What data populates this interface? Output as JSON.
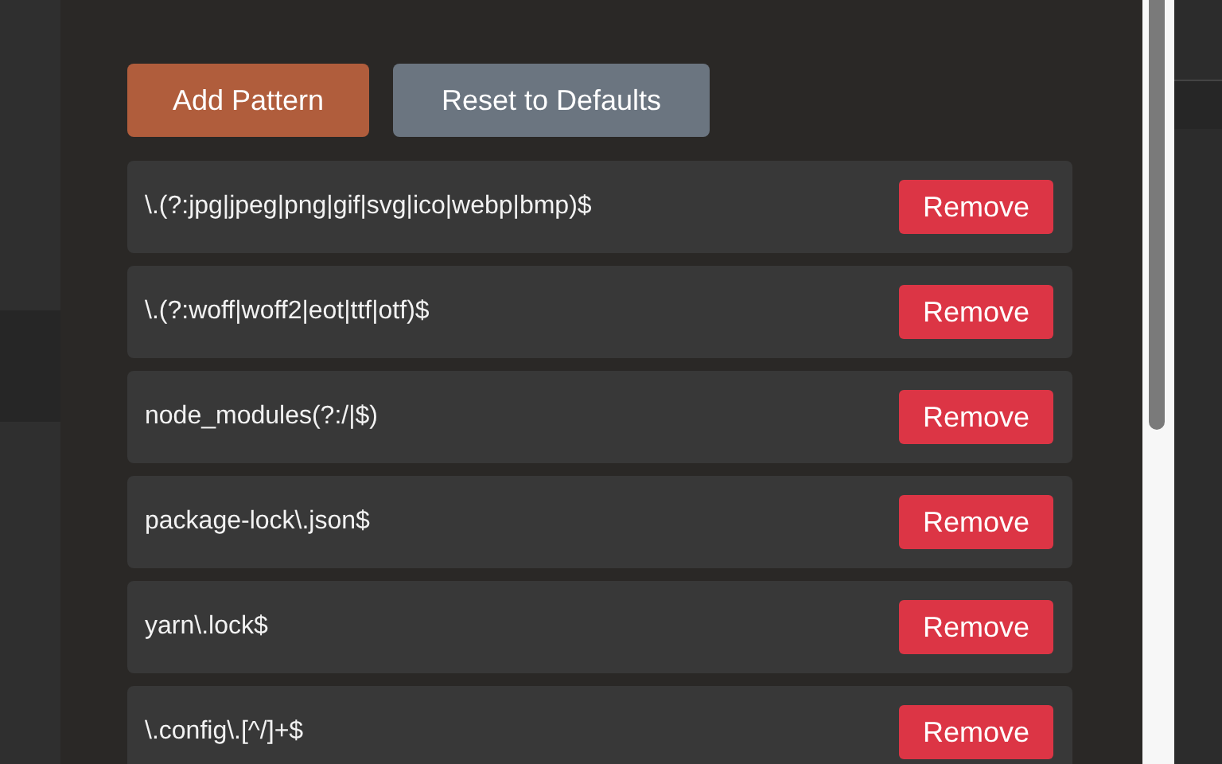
{
  "actions": [
    {
      "label": "Add Pattern",
      "kind": "primary"
    },
    {
      "label": "Reset to Defaults",
      "kind": "secondary"
    }
  ],
  "patterns": [
    {
      "pattern": "\\.(?:jpg|jpeg|png|gif|svg|ico|webp|bmp)$",
      "button": "Remove"
    },
    {
      "pattern": "\\.(?:woff|woff2|eot|ttf|otf)$",
      "button": "Remove"
    },
    {
      "pattern": "node_modules(?:/|$)",
      "button": "Remove"
    },
    {
      "pattern": "package-lock\\.json$",
      "button": "Remove"
    },
    {
      "pattern": "yarn\\.lock$",
      "button": "Remove"
    },
    {
      "pattern": "\\.config\\.[^/]+$",
      "button": "Remove"
    }
  ]
}
